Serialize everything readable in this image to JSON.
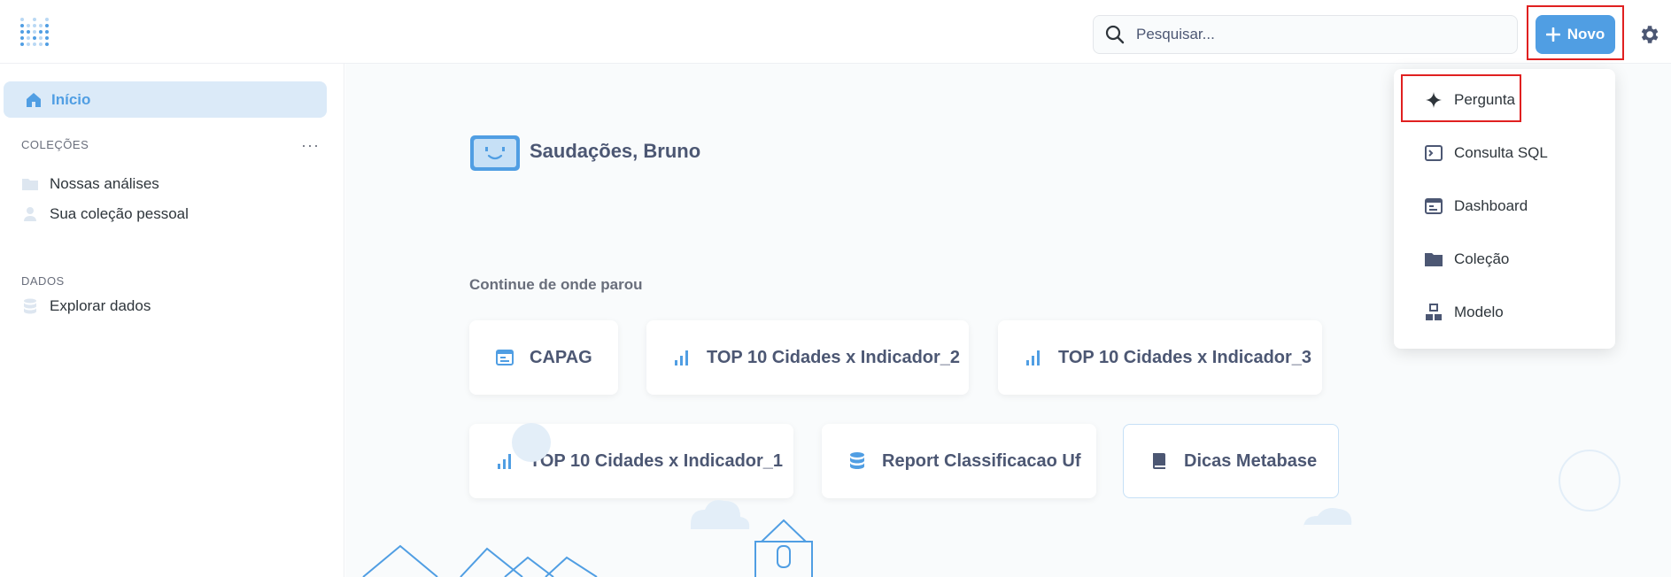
{
  "header": {
    "logo_icon": "metabase-logo-icon",
    "search": {
      "placeholder": "Pesquisar...",
      "icon": "search-icon"
    },
    "new_button": {
      "label": "Novo",
      "icon": "plus-icon"
    },
    "settings_icon": "gear-icon"
  },
  "sidebar": {
    "home": {
      "label": "Início",
      "icon": "home-icon"
    },
    "collections_title": "COLEÇÕES",
    "collections_more": "···",
    "collections": [
      {
        "label": "Nossas análises",
        "icon": "folder-icon"
      },
      {
        "label": "Sua coleção pessoal",
        "icon": "person-icon"
      }
    ],
    "data_title": "DADOS",
    "data_items": [
      {
        "label": "Explorar dados",
        "icon": "database-icon"
      }
    ]
  },
  "main": {
    "greeting": "Saudações, Bruno",
    "continue_title": "Continue de onde parou",
    "cards": [
      {
        "label": "CAPAG",
        "icon": "dashboard-icon"
      },
      {
        "label": "TOP 10 Cidades x Indicador_2",
        "icon": "bar-chart-icon"
      },
      {
        "label": "TOP 10 Cidades x Indicador_3",
        "icon": "bar-chart-icon"
      },
      {
        "label": "TOP 10 Cidades x Indicador_1",
        "icon": "bar-chart-icon"
      },
      {
        "label": "Report Classificacao Uf",
        "icon": "database-icon"
      },
      {
        "label": "Dicas Metabase",
        "icon": "book-icon"
      }
    ]
  },
  "new_menu": {
    "items": [
      {
        "label": "Pergunta",
        "icon": "sparkle-icon"
      },
      {
        "label": "Consulta SQL",
        "icon": "sql-icon"
      },
      {
        "label": "Dashboard",
        "icon": "dashboard-icon"
      },
      {
        "label": "Coleção",
        "icon": "folder-icon"
      },
      {
        "label": "Modelo",
        "icon": "model-icon"
      }
    ]
  },
  "colors": {
    "brand": "#509ee3",
    "highlight": "#e02020",
    "text": "#4c5773"
  }
}
